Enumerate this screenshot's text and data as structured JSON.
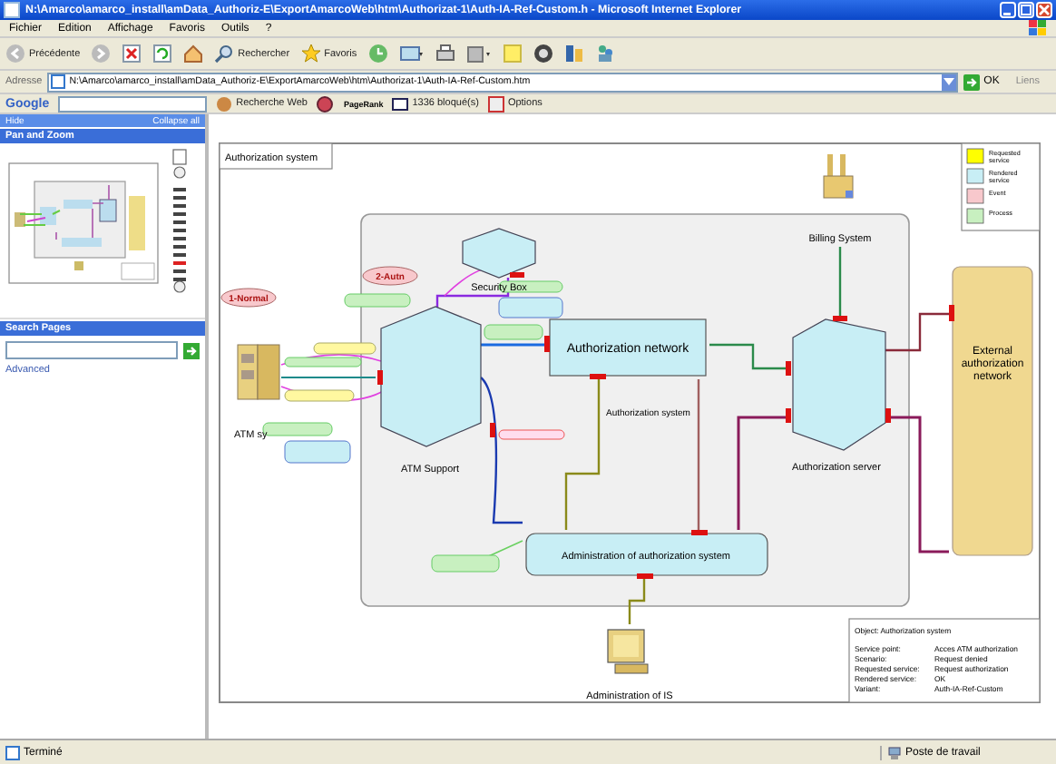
{
  "window": {
    "title": "N:\\Amarco\\amarco_install\\amData_Authoriz-E\\ExportAmarcoWeb\\htm\\Authorizat-1\\Auth-IA-Ref-Custom.h - Microsoft Internet Explorer"
  },
  "menu": [
    "Fichier",
    "Edition",
    "Affichage",
    "Favoris",
    "Outils",
    "?"
  ],
  "toolbar": {
    "back": "Précédente",
    "search": "Rechercher",
    "favorites": "Favoris"
  },
  "address": {
    "label": "Adresse",
    "value": "N:\\Amarco\\amarco_install\\amData_Authoriz-E\\ExportAmarcoWeb\\htm\\Authorizat-1\\Auth-IA-Ref-Custom.htm",
    "go": "OK",
    "links": "Liens"
  },
  "google_bar": {
    "logo": "Google",
    "search_web": "Recherche Web",
    "pagerank": "PageRank",
    "blocked": "1336 bloqué(s)",
    "options": "Options"
  },
  "sidebar": {
    "hide": "Hide",
    "collapse": "Collapse all",
    "pan_zoom": "Pan and Zoom",
    "search_title": "Search Pages",
    "advanced": "Advanced"
  },
  "diagram": {
    "title": "Authorization system",
    "inner_label": "Authorization system",
    "nodes": [
      {
        "kind": "device",
        "label": "Billing System"
      },
      {
        "kind": "box",
        "label": "Security Box"
      },
      {
        "kind": "atm",
        "label": "ATM sy"
      },
      {
        "kind": "cube",
        "label": "ATM Support"
      },
      {
        "kind": "network",
        "label": "Authorization network"
      },
      {
        "kind": "server",
        "label": "Authorization server"
      },
      {
        "kind": "external",
        "label": "External authorization network"
      },
      {
        "kind": "admin",
        "label": "Administration of authorization system"
      },
      {
        "kind": "terminal",
        "label": "Administration of IS"
      }
    ],
    "events": [
      "1-Normal",
      "2-Autn"
    ],
    "legend": [
      {
        "label": "Requested service",
        "color": "#ffff00"
      },
      {
        "label": "Rendered service",
        "color": "#c8eef5"
      },
      {
        "label": "Event",
        "color": "#f8c8cc"
      },
      {
        "label": "Process",
        "color": "#c8f0c0"
      }
    ],
    "info": {
      "object": "Object: Authorization system",
      "rows": [
        {
          "key": "Service point:",
          "value": "Acces ATM authorization"
        },
        {
          "key": "Scenario:",
          "value": "Request denied"
        },
        {
          "key": "Requested service:",
          "value": "Request authorization"
        },
        {
          "key": "Rendered service:",
          "value": "OK"
        },
        {
          "key": "Variant:",
          "value": "Auth-IA-Ref-Custom"
        }
      ]
    }
  },
  "status_bar": {
    "left": "Terminé",
    "right": "Poste de travail"
  }
}
